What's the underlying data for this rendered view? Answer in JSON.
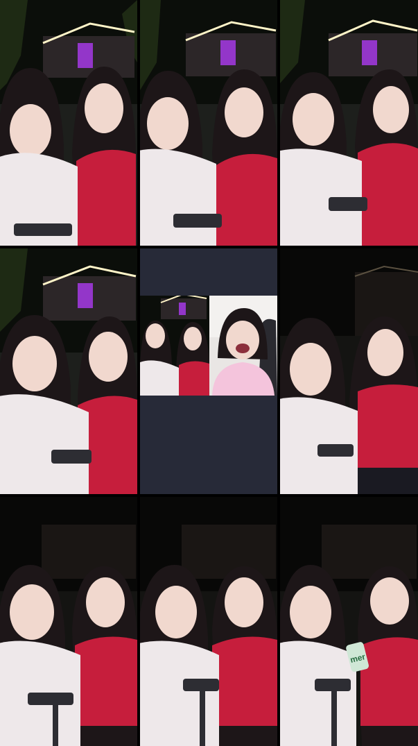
{
  "layout": {
    "kind": "3x3 video mosaic",
    "background": "#000000",
    "center_tile_background": "#272a38"
  },
  "palette": {
    "night_sky": "#0b0e0a",
    "trees": "#1e2a14",
    "cabin_wall": "#2c2628",
    "cabin_lights": "#fff4c8",
    "neon_purple": "#b53cff",
    "ground": "#1d1f1c",
    "skin": "#f1d8ce",
    "hair": "#1d1618",
    "red_top": "#c61e3c",
    "tshirt": "#eee8ea",
    "pink_shirt": "#f4c4dc",
    "gear": "#2d2d33"
  },
  "tiles": [
    {
      "id": "tile-1",
      "scene": "lit-cabin",
      "people": 2
    },
    {
      "id": "tile-2",
      "scene": "lit-cabin",
      "people": 2
    },
    {
      "id": "tile-3",
      "scene": "lit-cabin",
      "people": 2
    },
    {
      "id": "tile-4",
      "scene": "lit-cabin",
      "people": 2
    },
    {
      "id": "tile-5",
      "scene": "split-screen-inset",
      "people": 3
    },
    {
      "id": "tile-6",
      "scene": "dark-cabin",
      "people": 2
    },
    {
      "id": "tile-7",
      "scene": "dark-cabin",
      "people": 2
    },
    {
      "id": "tile-8",
      "scene": "dark-cabin",
      "people": 2
    },
    {
      "id": "tile-9",
      "scene": "dark-cabin",
      "people": 2
    }
  ],
  "microphone_tag": "mer"
}
